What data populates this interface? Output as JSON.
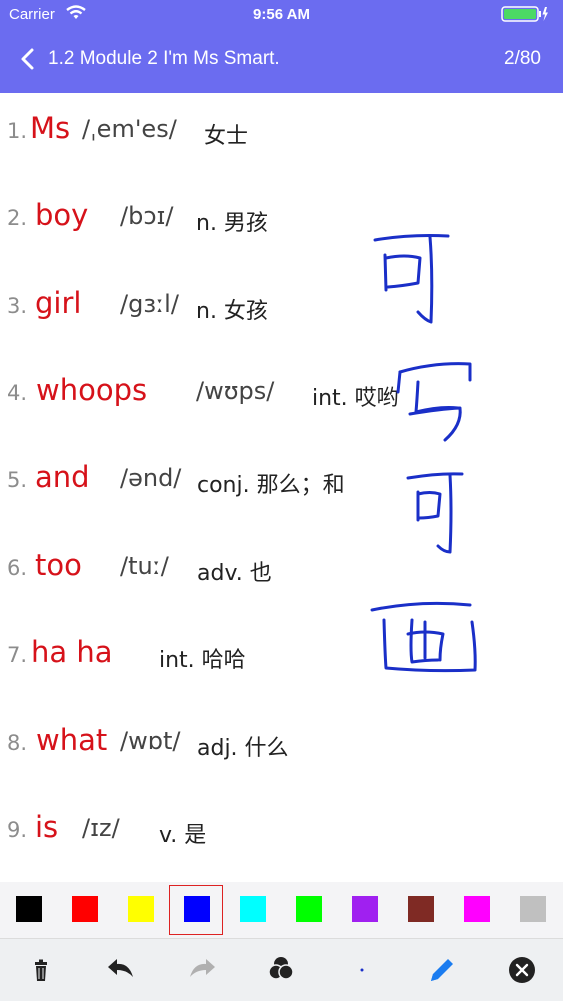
{
  "status_bar": {
    "carrier": "Carrier",
    "time": "9:56 AM"
  },
  "nav": {
    "title": "1.2 Module 2 I'm Ms Smart.",
    "counter": "2/80"
  },
  "words": [
    {
      "num": "1.",
      "word": "Ms",
      "ipa": "/ˌem'es/",
      "def": "女士"
    },
    {
      "num": "2.",
      "word": "boy",
      "ipa": "/bɔɪ/",
      "def": "n. 男孩"
    },
    {
      "num": "3.",
      "word": "girl",
      "ipa": "/gɜːl/",
      "def": "n. 女孩"
    },
    {
      "num": "4.",
      "word": "whoops",
      "ipa": "/wʊps/",
      "def": "int. 哎哟"
    },
    {
      "num": "5.",
      "word": "and",
      "ipa": "/ənd/",
      "def": "conj. 那么；和"
    },
    {
      "num": "6.",
      "word": "too",
      "ipa": "/tuː/",
      "def": "adv. 也"
    },
    {
      "num": "7.",
      "word": "ha ha",
      "ipa": "",
      "def": "int. 哈哈"
    },
    {
      "num": "8.",
      "word": "what",
      "ipa": "/wɒt/",
      "def": "adj. 什么"
    },
    {
      "num": "9.",
      "word": "is",
      "ipa": "/ɪz/",
      "def": "v. 是"
    }
  ],
  "palette": {
    "colors": [
      "#000000",
      "#ff0000",
      "#ffff00",
      "#0000ff",
      "#00ffff",
      "#00ff00",
      "#a020f0",
      "#7f2a24",
      "#ff00ff",
      "#c0c0c0"
    ],
    "selected_index": 3
  },
  "ink_color": "#1a2fc8",
  "toolbar": {
    "icons": [
      "trash-icon",
      "undo-icon",
      "redo-icon",
      "color-wheel-icon",
      "dot-size-icon",
      "pencil-icon",
      "close-icon"
    ]
  }
}
